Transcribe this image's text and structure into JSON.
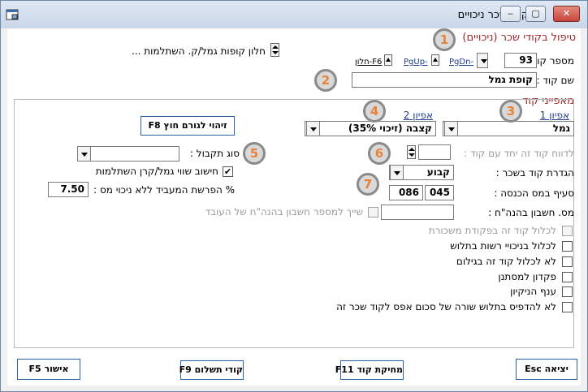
{
  "window": {
    "title": "קודי שכר ניכויים",
    "minimize": "‒",
    "maximize": "▢",
    "close": "✕"
  },
  "header": {
    "section_title": "טיפול בקודי שכר (ניכויים)",
    "code_number_label": "מספר קוד :",
    "code_number_value": "93",
    "pgdn": "PgDn-",
    "pgup": "PgUp-",
    "f6": "חלון-F6",
    "fund_window_link": "חלון קופות גמל/ק. השתלמות ...",
    "code_name_label": "שם קוד :",
    "code_name_value": "קופת גמל"
  },
  "features": {
    "title": "מאפייני קוד",
    "attr1_label": "אפיון 1",
    "attr1_value": "גמל",
    "attr2_label": "אפיון 2",
    "attr2_value": "קצבה (זיכוי 35%)",
    "f8_button": "זיהוי לגורם חוץ F8",
    "receipt_type_label": "סוג תקבול :",
    "receipt_type_value": "",
    "calc_fund_label": "חישוב שווי גמל/קרן השתלמות",
    "calc_fund_checked": "✔",
    "employer_pct_label": "% הפרשת המעביד ללא ניכוי מס :",
    "employer_pct_value": "7.50",
    "report_with_code_label": "לדווח קוד זה יחד עם קוד :",
    "report_with_code_value": "",
    "code_def_label": "הגדרת קוד בשכר :",
    "code_def_value": "קבוע",
    "income_tax_label": "סעיף במס הכנסה :",
    "income_tax_a": "045",
    "income_tax_b": "086",
    "bank_acc_label": "מס. חשבון בהנה\"ח :",
    "bank_acc_value": "",
    "assign_label": "שייך למספר חשבון בהנה\"ח של העובד",
    "checks": [
      {
        "label": "לכלול קוד זה בפקודת משכורת",
        "disabled": true
      },
      {
        "label": "לכלול בניכויי רשות בתלוש",
        "disabled": false
      },
      {
        "label": "לא לכלול קוד זה בגילום",
        "disabled": false
      },
      {
        "label": "פקדון למסתנן",
        "disabled": false
      },
      {
        "label": "ענף הניקיון",
        "disabled": false
      },
      {
        "label": "לא להדפיס בתלוש שורה של סכום אפס לקוד שכר זה",
        "disabled": false
      }
    ]
  },
  "badges": [
    "1",
    "2",
    "3",
    "4",
    "5",
    "6",
    "7"
  ],
  "footer": {
    "exit": "יציאה Esc",
    "delete": "מחיקת קוד F11",
    "payment_codes": "קודי תשלום F9",
    "confirm": "אישור F5"
  },
  "colors": {
    "accent_red": "#a0262b",
    "link_blue": "#1f3a8a",
    "badge_orange": "#e8813a"
  }
}
